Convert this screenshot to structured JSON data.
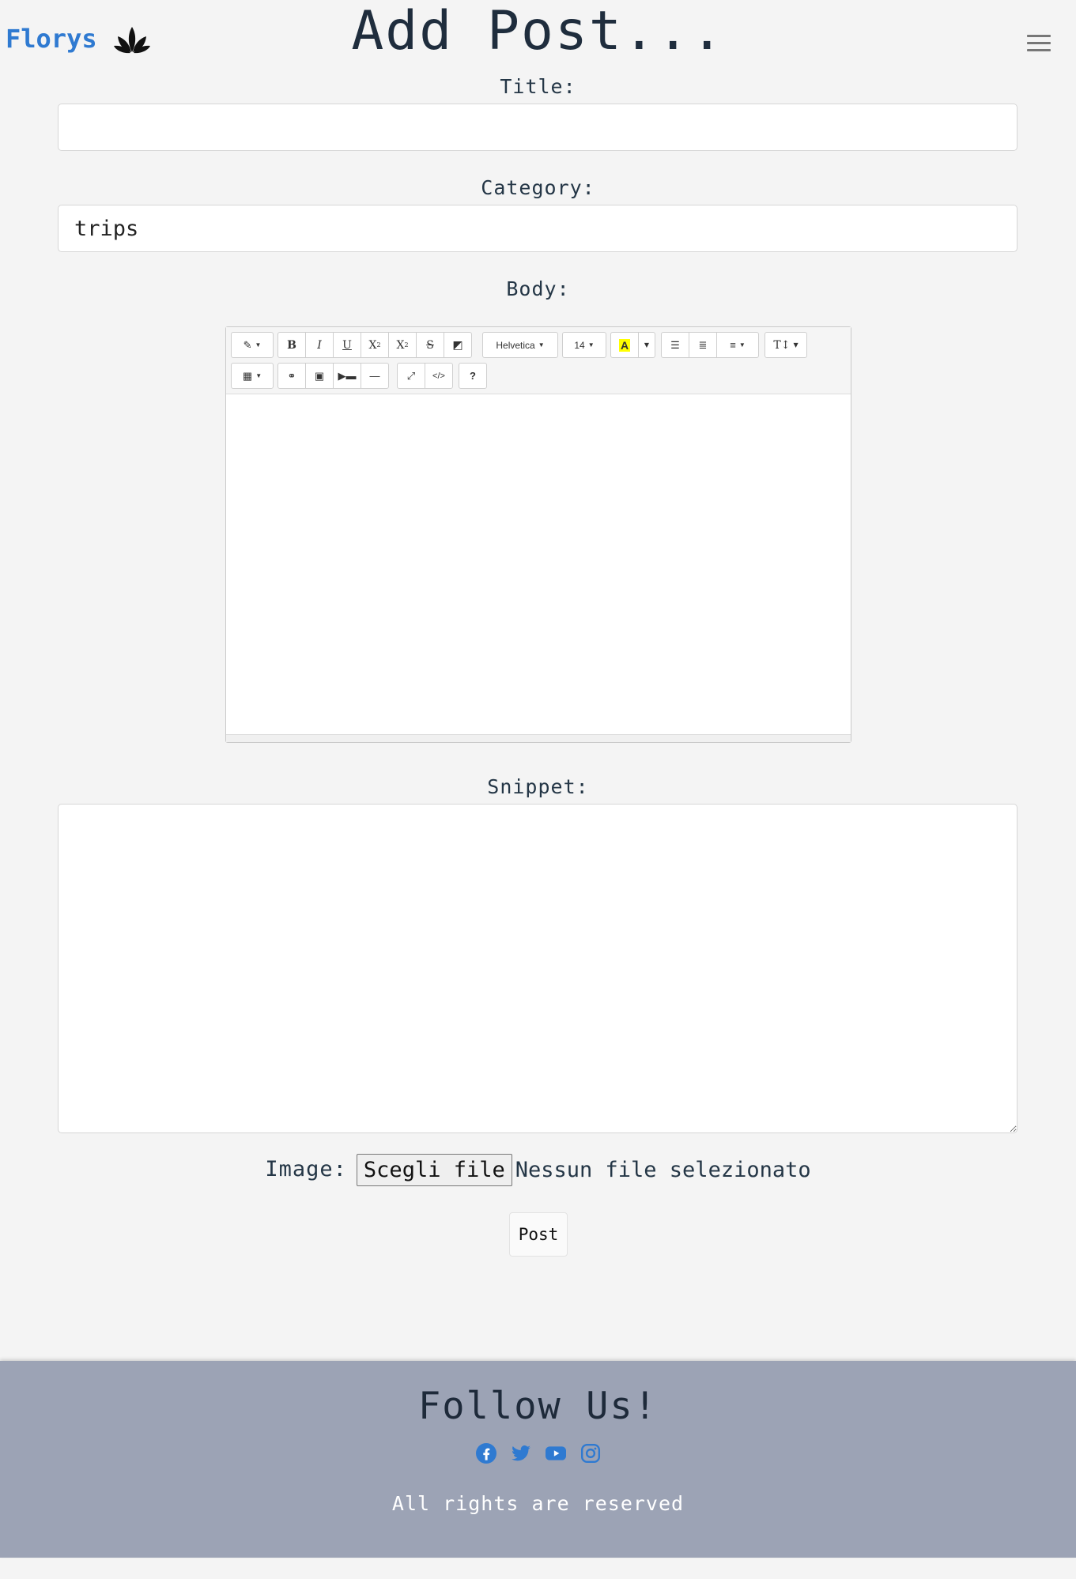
{
  "brand": {
    "name": "Florys",
    "icon": "lotus-icon"
  },
  "page": {
    "title": "Add Post..."
  },
  "menu": {
    "icon": "hamburger-menu-icon"
  },
  "form": {
    "title_label": "Title:",
    "title_value": "",
    "category_label": "Category:",
    "category_value": "trips",
    "body_label": "Body:",
    "snippet_label": "Snippet:",
    "image_label": "Image:",
    "file_button": "Scegli file",
    "file_status": "Nessun file selezionato",
    "submit_label": "Post"
  },
  "editor": {
    "toolbar": {
      "font_name": "Helvetica",
      "font_size": "14",
      "buttons": [
        "magic-wand",
        "bold",
        "italic",
        "underline",
        "superscript",
        "subscript",
        "strikethrough",
        "eraser",
        "font-name",
        "font-size",
        "color",
        "unordered-list",
        "ordered-list",
        "align",
        "line-height",
        "table",
        "link",
        "picture",
        "video",
        "horizontal-rule",
        "fullscreen",
        "code-view",
        "help"
      ]
    }
  },
  "footer": {
    "title": "Follow Us!",
    "socials": [
      "facebook-icon",
      "twitter-icon",
      "youtube-icon",
      "instagram-icon"
    ],
    "rights": "All rights are reserved"
  },
  "colors": {
    "brand": "#2f7ad1",
    "footer_bg": "#9ca3b5",
    "social": "#2f7ad1"
  }
}
